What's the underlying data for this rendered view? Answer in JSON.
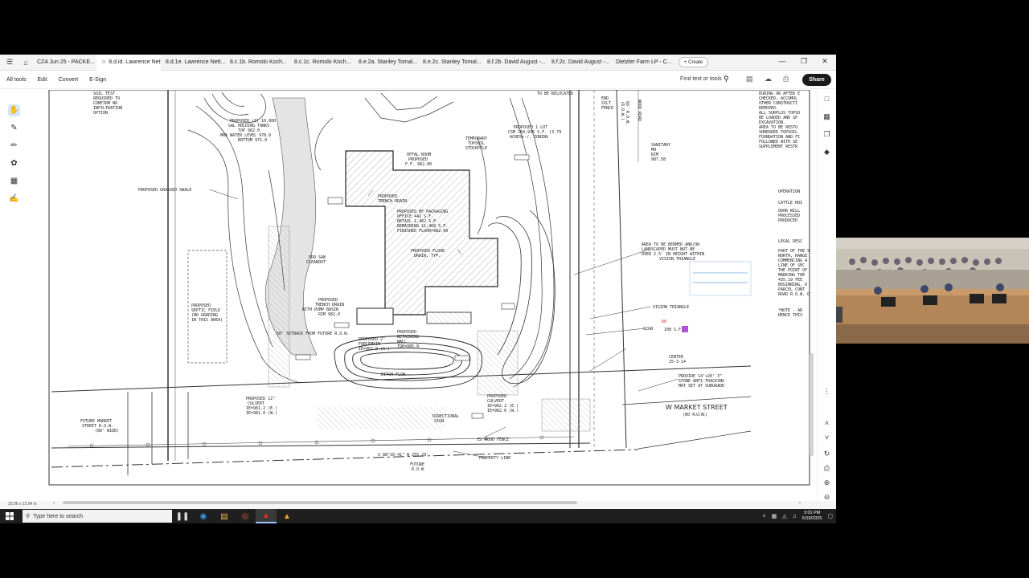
{
  "tabs": [
    {
      "label": "CZA Jun 25 - PACKE...",
      "active": false
    },
    {
      "label": "8.d.id. Lawrence Nettesh...",
      "active": true
    },
    {
      "label": "8.d.1e. Lawrence Nett...",
      "active": false
    },
    {
      "label": "8.c.1b. Romolo Koch...",
      "active": false
    },
    {
      "label": "8.c.1c. Romolo Koch...",
      "active": false
    },
    {
      "label": "8.e.2a. Stanley Tomal...",
      "active": false
    },
    {
      "label": "8.e.2c. Stanley Tomal...",
      "active": false
    },
    {
      "label": "8.f.2b. David August -...",
      "active": false
    },
    {
      "label": "8.f.2c. David August -...",
      "active": false
    },
    {
      "label": "Dietzler Farm LP - C...",
      "active": false
    }
  ],
  "create_label": "+ Create",
  "menu": {
    "items": [
      "All tools",
      "Edit",
      "Convert",
      "E-Sign"
    ],
    "find_placeholder": "Find text or tools",
    "share_label": "Share"
  },
  "status": {
    "page_size": "35.86 x 23.94 in"
  },
  "taskbar": {
    "search_placeholder": "Type here to search",
    "time": "3:01 PM",
    "date": "6/19/2025"
  },
  "plan": {
    "labels": {
      "soil_test": [
        "SOIL TEST",
        "REQUIRED TO",
        "CONFIRM NO",
        "INFILTRATION",
        "OPTION"
      ],
      "holding_tanks": [
        "PROPOSED (3) 10,000",
        "GAL HOLDING TANKS",
        "TOP 982.0",
        "MAX WATER LEVEL 978.6",
        "BOTTOM 971.0"
      ],
      "grassed_swale": "PROPOSED GRASSED SWALE",
      "offal_room": [
        "OFFAL ROOM",
        "PROPOSED",
        "F.F. 982.00"
      ],
      "topsoil": [
        "TEMPORARY",
        "TOPSOIL",
        "STOCKPILE"
      ],
      "lot": [
        "PROPOSED 1 LOT",
        "CSM 164,936 S.F. (3.79",
        "ACRES+-/, ZONING"
      ],
      "trench_drain_1": [
        "PROPOSED",
        "TRENCH DRAIN"
      ],
      "packaging": [
        "PROPOSED NF PACKAGING",
        "OFFICE 441 S.F.",
        "RETAIL 1,462 S.F.",
        "REMAINING 11,468 S.F.",
        "FINISHED FLOOR=982.00"
      ],
      "floor_drain": [
        "PROPOSED FLOOR",
        "DRAIN, TYP."
      ],
      "san_cleanout": [
        "PRO SAN",
        "CLEANOUT"
      ],
      "septic": [
        "PROPOSED",
        "SEPTIC FIELD",
        "(NO GRADING",
        "IN THIS AREA)"
      ],
      "trench_pump": [
        "PROPOSED",
        "TRENCH DRAIN",
        "WITH PUMP BASIN",
        "RIM 982.0"
      ],
      "setback": "50' SETBACK FROM FUTURE R.O.W.",
      "forcemain": [
        "PROPOSED 2\"",
        "FORCEMAIN",
        "IE=982.0 (S.)"
      ],
      "retaining_wall": [
        "PROPOSED",
        "RETAINING",
        "WALL",
        "TOP=985.0"
      ],
      "ditch_flow": "DITCH FLOW",
      "culvert_w": [
        "PROPOSED 12\"",
        "CULVERT",
        "IE=981.2 (E.)",
        "IE=981.0 (W.)"
      ],
      "culvert_e": [
        "PROPOSED",
        "CULVERT",
        "IE=982.2 (E.)",
        "IE=982.0 (W.)"
      ],
      "directional_sign": [
        "DIRECTIONAL",
        "SIGN"
      ],
      "wood_fence": "EX WOOD FENCE",
      "property_line": "PROPERTY LINE",
      "future_market": [
        "FUTURE MARKET",
        "STREET R.O.W.",
        "(80' WIDE)"
      ],
      "future_row": [
        "FUTURE",
        "R.O.W."
      ],
      "bearing": "S 88°16'41\" W  255.29'",
      "bermed": [
        "AREA TO BE BERMED AND/OR",
        "LANDSCAPED MUST NOT BE",
        "OVER 2.5' IN HEIGHT WITHIN",
        "VISION TRIANGLE"
      ],
      "vision_triangle": "VISION TRIANGLE",
      "sign": "SIGN",
      "sign_area": "100 S.F.",
      "sign_number": "60",
      "centerline": [
        "CENTER",
        "25-3-14"
      ],
      "stone_apron": [
        "PROVIDE 14'x20' 3\"",
        "STONE ANTI-TRACKING",
        "MAT SET AT SUBGRADE"
      ],
      "market_street": "W MARKET STREET",
      "row_width": "(80' R.O.W.)",
      "sanitary": [
        "SANITARY",
        "MH",
        "RIM",
        "987.58"
      ],
      "silt_fence": [
        "END",
        "SILT",
        "FENCE"
      ],
      "to_be_relocated": "TO BE RELOCATED",
      "wood_road": "WOOD ROAD",
      "row_66": [
        "66' R.O.W.",
        "(R.O.W.)"
      ],
      "right_notes": [
        "DURING OR AFTER E",
        "CHECKED, ACCUMUL",
        "OTHER CONSTRUCTI",
        "REMOVED.",
        "",
        "ALL SURPLUS TOPSO",
        "BE LOADED AND SP",
        "EXCAVATION.",
        "",
        "AREA TO BE RESTO",
        "SHREDDED TOPSOIL",
        "FOUNDATION AND FI",
        "FOLLOWED WITH SE",
        "SUPPLEMENT RESTR"
      ],
      "right_headers": [
        "OPERATION",
        "CATTLE HOI",
        "ODOR WILL",
        "PROCESSED",
        "PRODUCED"
      ],
      "legal_desc": [
        "LEGAL DESC",
        "PART OF THE S",
        "NORTH, RANGE",
        "COMMENCING A",
        "LINE OF SEC",
        "THE POINT OF",
        "MARKING THE",
        "435.19 FEE",
        "BEGINNING, D",
        "PARCEL CONT",
        "ROAD R.O.W. O"
      ],
      "notes_ref": [
        "*NOTE - AR",
        "HENCE THIS"
      ]
    }
  }
}
